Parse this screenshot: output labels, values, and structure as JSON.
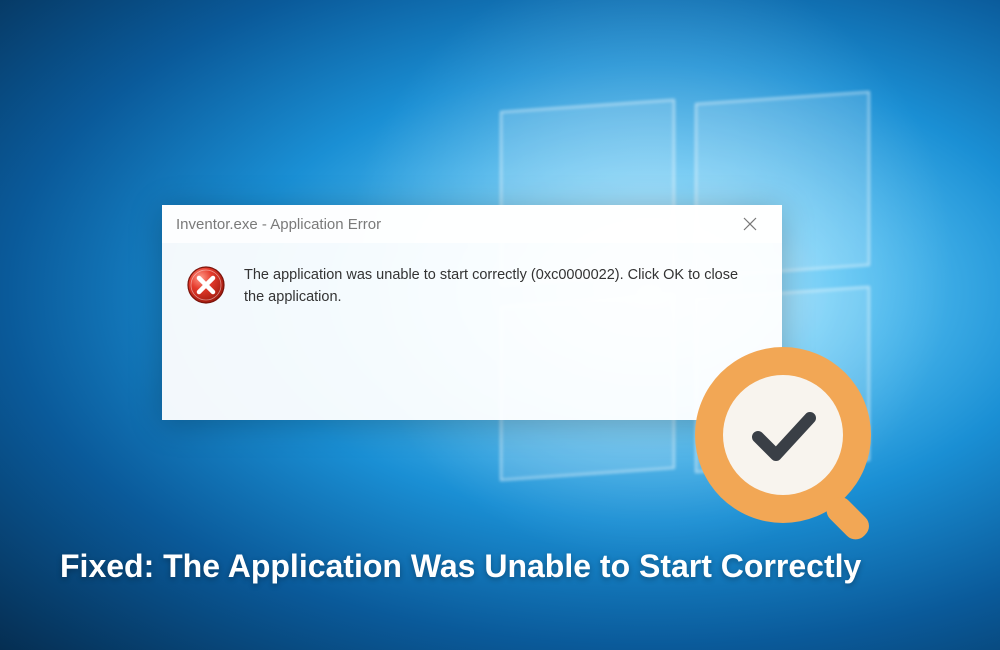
{
  "dialog": {
    "title": "Inventor.exe - Application Error",
    "message": "The application was unable to start correctly (0xc0000022). Click OK to close the application.",
    "close_label": "Close"
  },
  "caption": "Fixed: The Application Was Unable to Start Correctly",
  "icons": {
    "error": "error-circle-x",
    "close": "close-x",
    "magnifier_check": "magnifier-checkmark",
    "windows_logo": "windows-panes"
  },
  "colors": {
    "accent_orange": "#f2a755",
    "check_dark": "#3a3f46",
    "error_red": "#d93025",
    "bg_light": "#b8e8ff"
  }
}
